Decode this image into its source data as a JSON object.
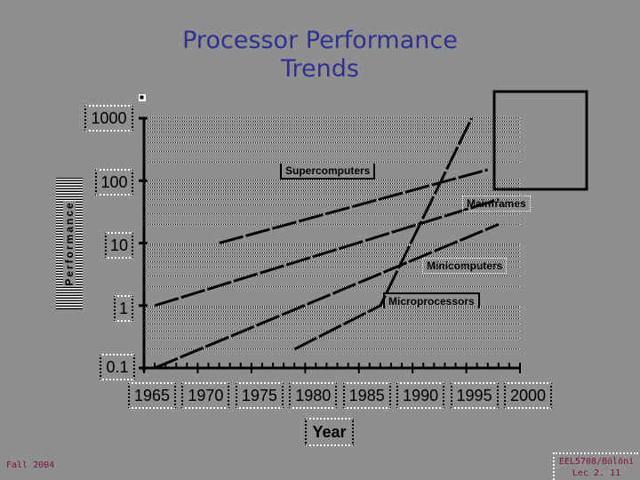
{
  "slide": {
    "title_line1": "Processor Performance",
    "title_line2": "Trends",
    "footer_left": "Fall 2004",
    "footer_right_line1": "EEL5708/Bölöni",
    "footer_right_line2": "Lec 2. 11"
  },
  "chart_data": {
    "type": "line",
    "title": "Processor Performance Trends",
    "xlabel": "Year",
    "ylabel": "Performance",
    "yscale": "log",
    "xlim": [
      1965,
      2000
    ],
    "ylim": [
      0.1,
      1000
    ],
    "x_ticks": [
      "1965",
      "1970",
      "1975",
      "1980",
      "1985",
      "1990",
      "1995",
      "2000"
    ],
    "y_ticks": [
      "1000",
      "100",
      "10",
      "1",
      "0.1"
    ],
    "grid": true,
    "series": [
      {
        "name": "Supercomputers",
        "points": [
          [
            1972,
            10
          ],
          [
            1997,
            150
          ]
        ]
      },
      {
        "name": "Mainframes",
        "points": [
          [
            1966,
            1
          ],
          [
            1998,
            50
          ]
        ]
      },
      {
        "name": "Minicomputers",
        "points": [
          [
            1966,
            0.1
          ],
          [
            1998,
            20
          ]
        ]
      },
      {
        "name": "Microprocessors",
        "points": [
          [
            1979,
            0.2
          ],
          [
            1987,
            1
          ],
          [
            1995.5,
            1000
          ]
        ]
      }
    ]
  }
}
